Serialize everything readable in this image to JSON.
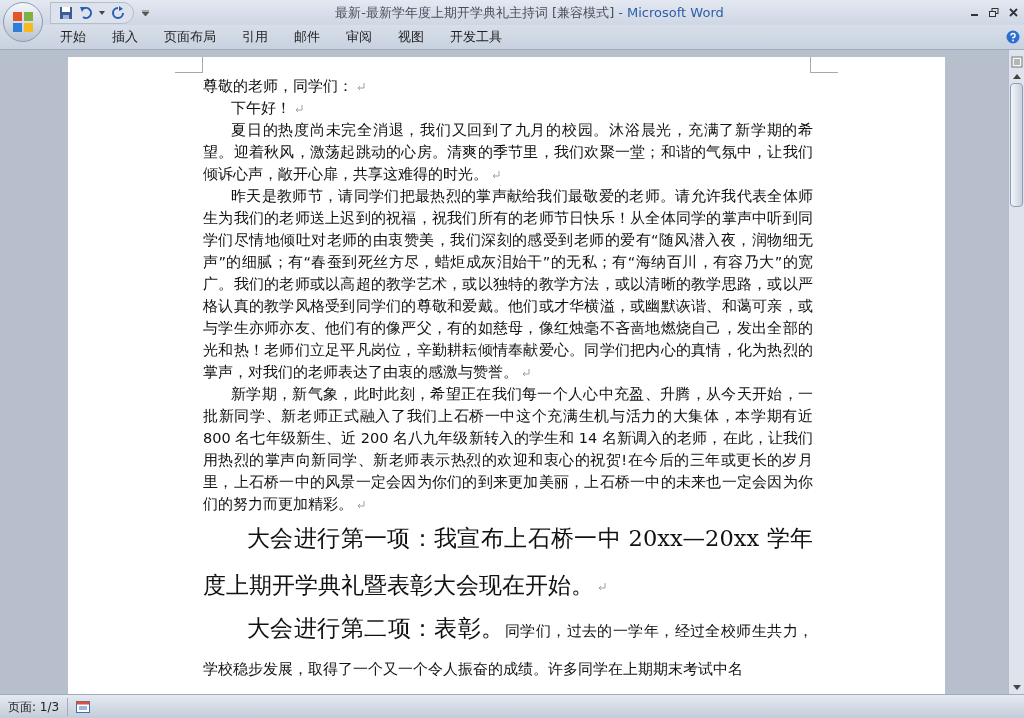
{
  "window": {
    "title": "最新-最新学年度上期开学典礼主持词 [兼容模式]",
    "app": "- Microsoft Word"
  },
  "ribbon_tabs": [
    {
      "label": "开始",
      "selected": false
    },
    {
      "label": "插入",
      "selected": false
    },
    {
      "label": "页面布局",
      "selected": false
    },
    {
      "label": "引用",
      "selected": false
    },
    {
      "label": "邮件",
      "selected": false
    },
    {
      "label": "审阅",
      "selected": false
    },
    {
      "label": "视图",
      "selected": false
    },
    {
      "label": "开发工具",
      "selected": false
    }
  ],
  "document": {
    "paragraphs": [
      {
        "kind": "body",
        "indent": false,
        "mark": true,
        "text": "尊敬的老师，同学们："
      },
      {
        "kind": "body",
        "indent": true,
        "mark": true,
        "text": "下午好！"
      },
      {
        "kind": "body",
        "indent": true,
        "mark": true,
        "text": "夏日的热度尚未完全消退，我们又回到了九月的校园。沐浴晨光，充满了新学期的希望。迎着秋风，激荡起跳动的心房。清爽的季节里，我们欢聚一堂；和谐的气氛中，让我们倾诉心声，敞开心扉，共享这难得的时光。"
      },
      {
        "kind": "body",
        "indent": true,
        "mark": true,
        "text": "昨天是教师节，请同学们把最热烈的掌声献给我们最敬爱的老师。请允许我代表全体师生为我们的老师送上迟到的祝福，祝我们所有的老师节日快乐！从全体同学的掌声中听到同学们尽情地倾吐对老师的由衷赞美，我们深刻的感受到老师的爱有“随风潜入夜，润物细无声”的细腻；有“春蚕到死丝方尽，蜡炬成灰泪始干”的无私；有“海纳百川，有容乃大”的宽广。我们的老师或以高超的教学艺术，或以独特的教学方法，或以清晰的教学思路，或以严格认真的教学风格受到同学们的尊敬和爱戴。他们或才华横溢，或幽默诙谐、和蔼可亲，或与学生亦师亦友、他们有的像严父，有的如慈母，像红烛毫不吝啬地燃烧自己，发出全部的光和热！老师们立足平凡岗位，辛勤耕耘倾情奉献爱心。同学们把内心的真情，化为热烈的掌声，对我们的老师表达了由衷的感激与赞誉。"
      },
      {
        "kind": "body",
        "indent": true,
        "mark": true,
        "text": "新学期，新气象，此时此刻，希望正在我们每一个人心中充盈、升腾，从今天开始，一批新同学、新老师正式融入了我们上石桥一中这个充满生机与活力的大集体，本学期有近800 名七年级新生、近 200 名八九年级新转入的学生和 14 名新调入的老师，在此，让我们用热烈的掌声向新同学、新老师表示热烈的欢迎和衷心的祝贺!在今后的三年或更长的岁月里，上石桥一中的风景一定会因为你们的到来更加美丽，上石桥一中的未来也一定会因为你们的努力而更加精彩。"
      },
      {
        "kind": "heading",
        "indent": true,
        "mark": true,
        "text": "大会进行第一项：我宣布上石桥一中 20xx—20xx 学年度上期开学典礼暨表彰大会现在开始。"
      },
      {
        "kind": "mixed",
        "indent": true,
        "mark": false,
        "lead": "大会进行第二项：表彰。",
        "text": "同学们，过去的一学年，经过全校师生共力，学校稳步发展，取得了一个又一个令人振奋的成绩。许多同学在上期期末考试中名"
      }
    ]
  },
  "status_bar": {
    "page": "页面: 1/3"
  }
}
